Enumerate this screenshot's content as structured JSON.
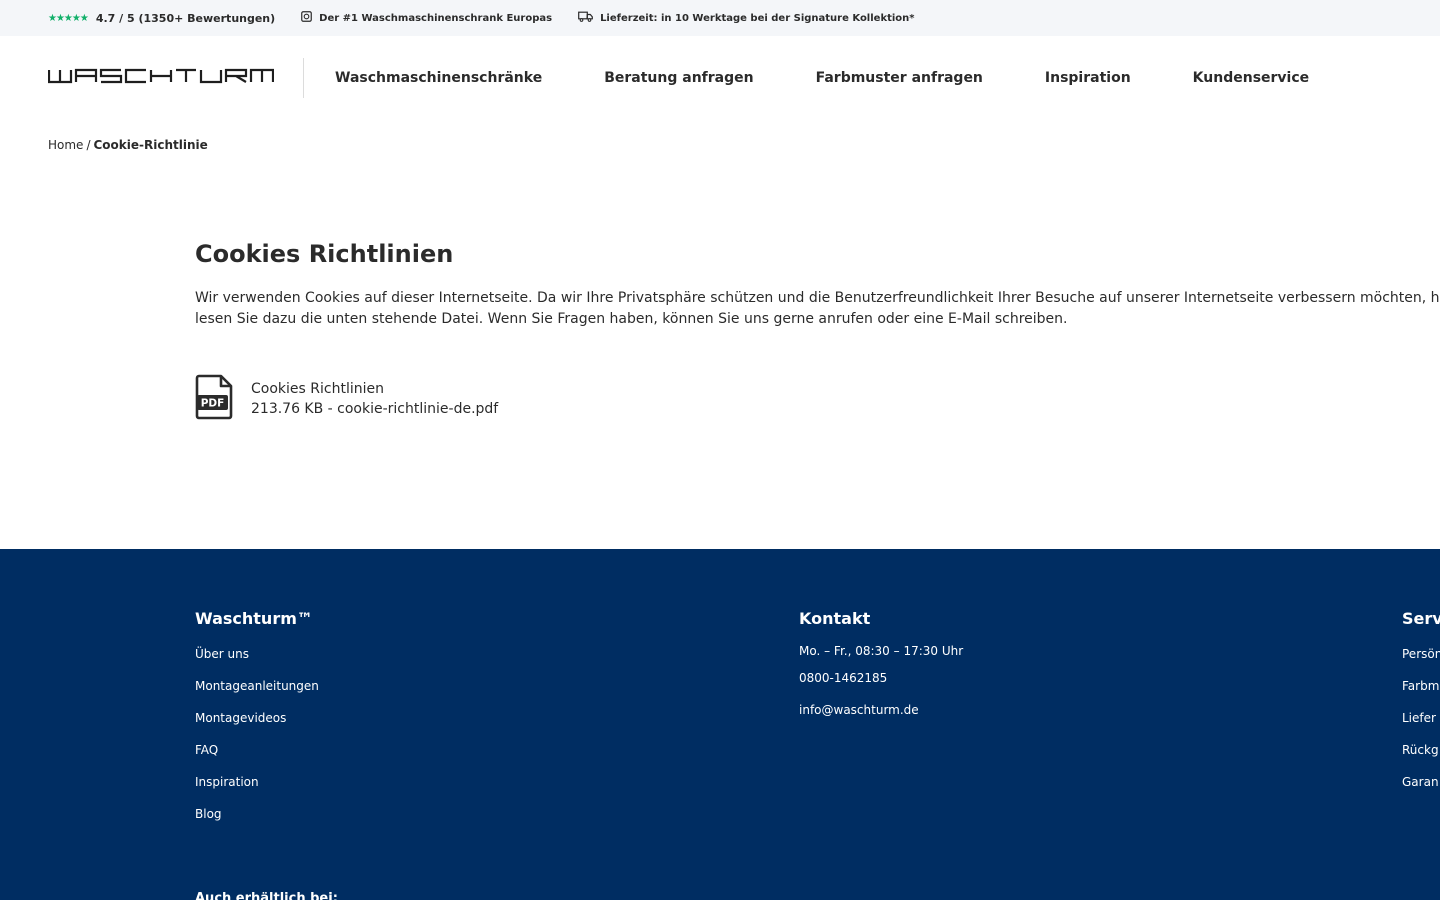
{
  "topbar": {
    "stars": "★★★★★",
    "rating": "4.7 / 5 (1350+ Bewertungen)",
    "claim": "Der #1 Waschmaschinenschrank Europas",
    "delivery": "Lieferzeit: in 10 Werktage bei der Signature Kollektion*",
    "star_color": "#12b06a"
  },
  "header": {
    "logo_text": "WASCHTURM",
    "nav": [
      {
        "label": "Waschmaschinenschränke"
      },
      {
        "label": "Beratung anfragen"
      },
      {
        "label": "Farbmuster anfragen"
      },
      {
        "label": "Inspiration"
      },
      {
        "label": "Kundenservice"
      }
    ]
  },
  "breadcrumb": {
    "home": "Home",
    "separator": "/",
    "current": "Cookie-Richtlinie"
  },
  "main": {
    "title": "Cookies Richtlinien",
    "intro_line1": "Wir verwenden Cookies auf dieser Internetseite. Da wir Ihre Privatsphäre schützen und die Benutzerfreundlichkeit Ihrer Besuche auf unserer Internetseite verbessern möchten, halten wir",
    "intro_line2": "lesen Sie dazu die unten stehende Datei. Wenn Sie Fragen haben, können Sie uns gerne anrufen oder eine E-Mail schreiben.",
    "file": {
      "icon_label": "PDF",
      "name": "Cookies Richtlinien",
      "detail": "213.76 KB - cookie-richtlinie-de.pdf"
    }
  },
  "footer": {
    "background": "#002d62",
    "col1": {
      "title": "Waschturm™",
      "links": [
        "Über uns",
        "Montageanleitungen",
        "Montagevideos",
        "FAQ",
        "Inspiration",
        "Blog"
      ]
    },
    "col2": {
      "title": "Kontakt",
      "hours": "Mo. – Fr., 08:30 – 17:30 Uhr",
      "phone": "0800-1462185",
      "email": "info@waschturm.de"
    },
    "col3": {
      "title": "Serv",
      "links": [
        "Persön",
        "Farbm",
        "Liefer",
        "Rückg",
        "Garan"
      ]
    },
    "also_available": "Auch erhältlich bei:"
  }
}
